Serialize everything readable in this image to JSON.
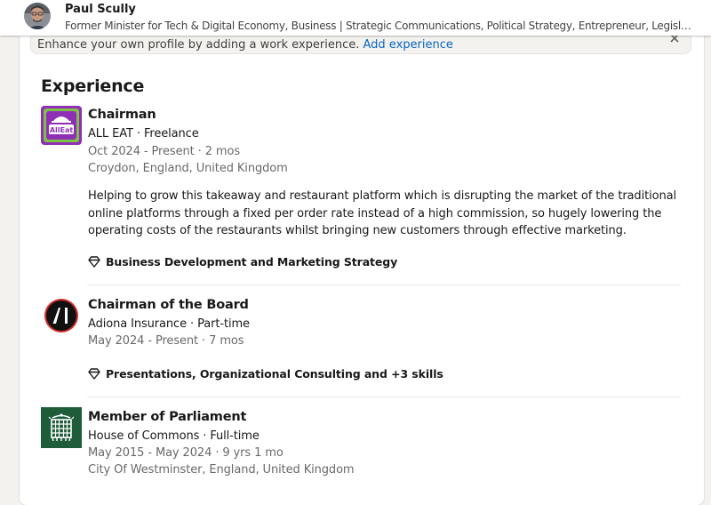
{
  "header": {
    "name": "Paul Scully",
    "headline": "Former Minister for Tech & Digital Economy, Business | Strategic Communications, Political Strategy, Entrepreneur, Legislator who focuses on delivering results"
  },
  "banner": {
    "text": "Enhance your own profile by adding a work experience.",
    "link": "Add experience"
  },
  "section": {
    "title": "Experience"
  },
  "experiences": [
    {
      "logo_text": "AllEat",
      "title": "Chairman",
      "company_line": "ALL EAT · Freelance",
      "dates": "Oct 2024 - Present · 2 mos",
      "location": "Croydon, England, United Kingdom",
      "description": "Helping to grow this takeaway and restaurant platform which is disrupting the market of the traditional online platforms through a fixed per order rate instead of a high commission, so hugely lowering the operating costs of the restaurants whilst bringing new customers through effective marketing.",
      "skills": "Business Development and Marketing Strategy"
    },
    {
      "logo_text": "AI",
      "title": "Chairman of the Board",
      "company_line": "Adiona Insurance · Part-time",
      "dates": "May 2024 - Present · 7 mos",
      "skills": "Presentations, Organizational Consulting and +3 skills"
    },
    {
      "title": "Member of Parliament",
      "company_line": "House of Commons · Full-time",
      "dates": "May 2015 - May 2024 · 9 yrs 1 mo",
      "location": "City Of Westminster, England, United Kingdom"
    }
  ],
  "colors": {
    "link": "#0a66c2",
    "alleat_purple": "#8e2fb5",
    "alleat_green": "#7dc242",
    "commons_green": "#1f5c3a"
  }
}
